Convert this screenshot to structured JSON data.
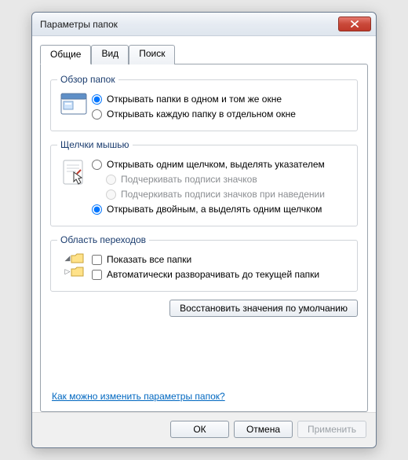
{
  "window": {
    "title": "Параметры папок"
  },
  "tabs": {
    "general": "Общие",
    "view": "Вид",
    "search": "Поиск"
  },
  "group_browse": {
    "legend": "Обзор папок",
    "opt_same": "Открывать папки в одном и том же окне",
    "opt_own": "Открывать каждую папку в отдельном окне"
  },
  "group_click": {
    "legend": "Щелчки мышью",
    "opt_single": "Открывать одним щелчком, выделять указателем",
    "opt_underline_always": "Подчеркивать подписи значков",
    "opt_underline_hover": "Подчеркивать подписи значков при наведении",
    "opt_double": "Открывать двойным, а выделять одним щелчком"
  },
  "group_nav": {
    "legend": "Область переходов",
    "opt_showall": "Показать все папки",
    "opt_autoexpand": "Автоматически разворачивать до текущей папки"
  },
  "buttons": {
    "restore": "Восстановить значения по умолчанию",
    "ok": "ОК",
    "cancel": "Отмена",
    "apply": "Применить"
  },
  "help_link": "Как можно изменить параметры папок?"
}
